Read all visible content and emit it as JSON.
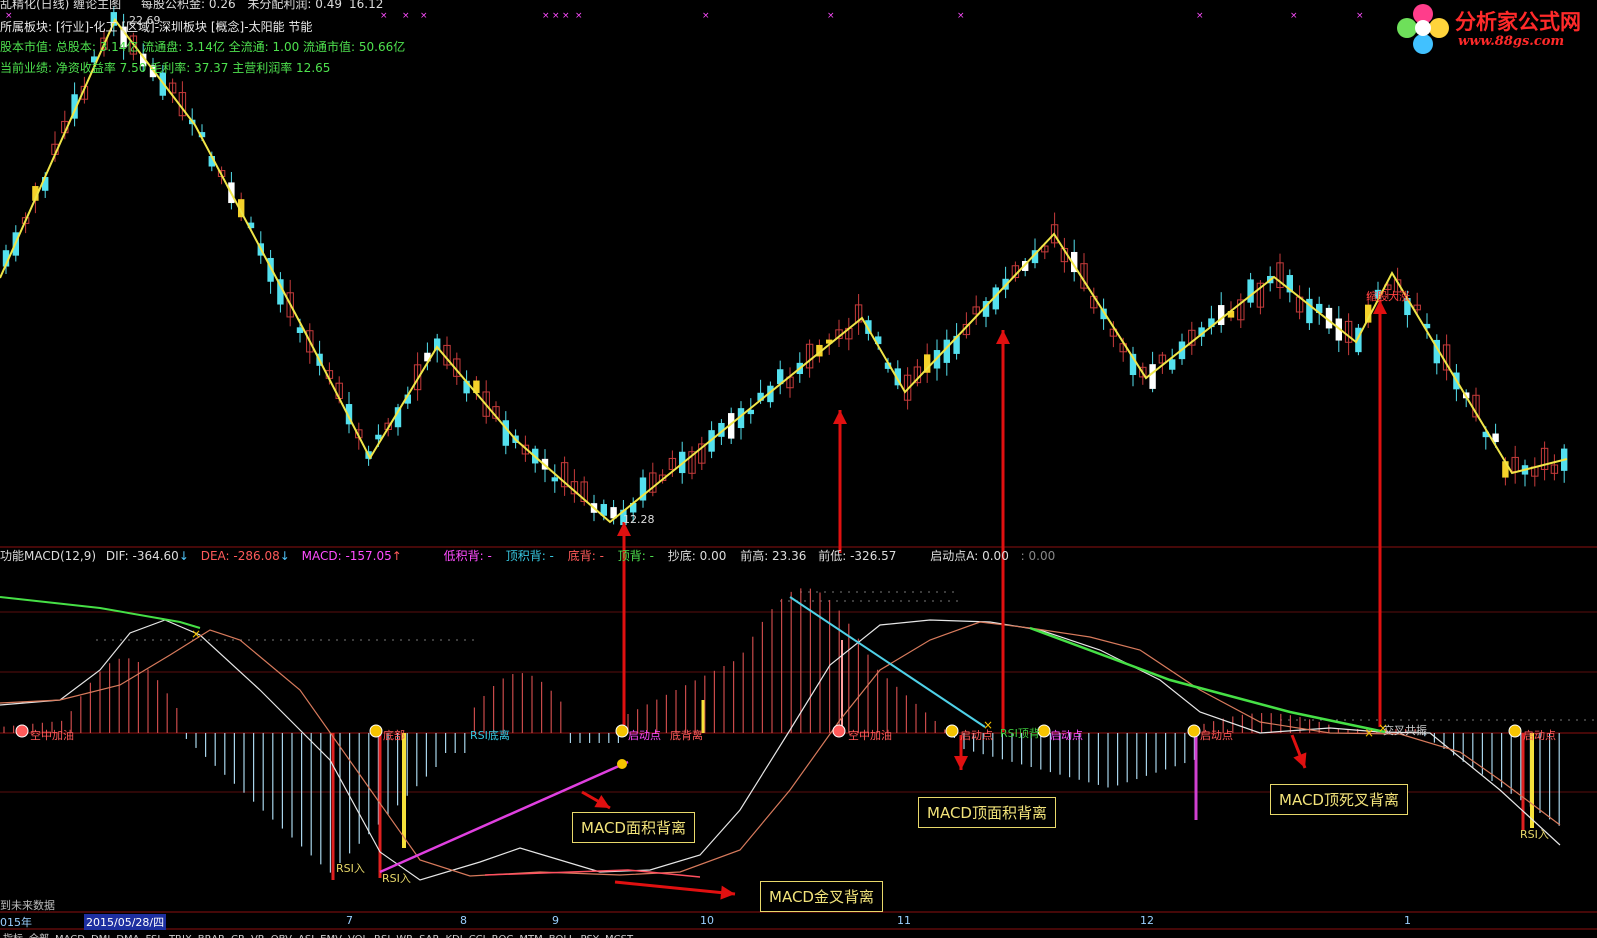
{
  "header": {
    "title": "乱精化(日线) 缠论主图",
    "fund": "每股公积金: 0.26",
    "profit": "未分配利润: 0.49",
    "price_tag": "16.12",
    "sector": "所属板块: [行业]-化工 [区域]-深圳板块 [概念]-太阳能 节能",
    "capital": "股本市值: 总股本: 3.14亿 流通盘: 3.14亿 全流通: 1.00 流通市值: 50.66亿",
    "performance": "当前业绩: 净资收益率 7.50 毛利率: 37.37 主营利润率 12.65"
  },
  "logo": {
    "title": "分析家公式网",
    "url": "www.88gs.com",
    "colors": [
      "#ff3d8b",
      "#ffd43b",
      "#41c1ff",
      "#6ee05a"
    ]
  },
  "price_panel": {
    "high_label": "22.69",
    "low_label": "12.28",
    "stock_label": "缩股大涨"
  },
  "indicator": {
    "title": "功能MACD(12,9)",
    "dif": "DIF: -364.60",
    "dea": "DEA: -286.08",
    "macd": "MACD: -157.05",
    "low_area": "低积背: -",
    "top_area": "顶积背: -",
    "bottom": "底背: -",
    "top": "顶背: -",
    "bottom_buy": "抄底: 0.00",
    "prev_high": "前高: 23.36",
    "prev_low": "前低: -326.57",
    "start_a": "启动点A: 0.00",
    "end": ": 0.00"
  },
  "signals": [
    {
      "label": "空中加油",
      "color": "#ff5a5a"
    },
    {
      "label": "底部",
      "color": "#ff5a5a"
    },
    {
      "label": "RSI底离",
      "color": "#37c7e0"
    },
    {
      "label": "启动点",
      "color": "#ff4dff"
    },
    {
      "label": "底背离",
      "color": "#ff5a5a"
    },
    {
      "label": "空中加油",
      "color": "#ff5a5a"
    },
    {
      "label": "启动点",
      "color": "#ff5a5a"
    },
    {
      "label": "RSI顶背",
      "color": "#3dc73d"
    },
    {
      "label": "启动点",
      "color": "#ff4dff"
    },
    {
      "label": "启动点",
      "color": "#ff5a5a"
    },
    {
      "label": "交叉共振",
      "color": "#cccccc"
    },
    {
      "label": "启动点",
      "color": "#ff5a5a"
    }
  ],
  "rsi_labels": [
    "RSI入",
    "RSI入",
    "RSI入"
  ],
  "annotations": {
    "macd_area": "MACD面积背离",
    "macd_top_area": "MACD顶面积背离",
    "macd_golden": "MACD金叉背离",
    "macd_dead": "MACD顶死叉背离"
  },
  "footer": {
    "future": "到未来数据",
    "year": "015年",
    "date": "2015/05/28/四",
    "months": [
      "7",
      "8",
      "9",
      "10",
      "11",
      "12",
      "1"
    ],
    "menu": [
      "指标",
      "全部",
      "MACD",
      "DMI",
      "DMA",
      "FSL",
      "TRIX",
      "BRAR",
      "CR",
      "VR",
      "OBV",
      "ASI",
      "EMV",
      "VOL",
      "RSI",
      "WR",
      "SAR",
      "KDJ",
      "CCI",
      "ROC",
      "MTM",
      "BOLL",
      "PSY",
      "MCST"
    ]
  }
}
